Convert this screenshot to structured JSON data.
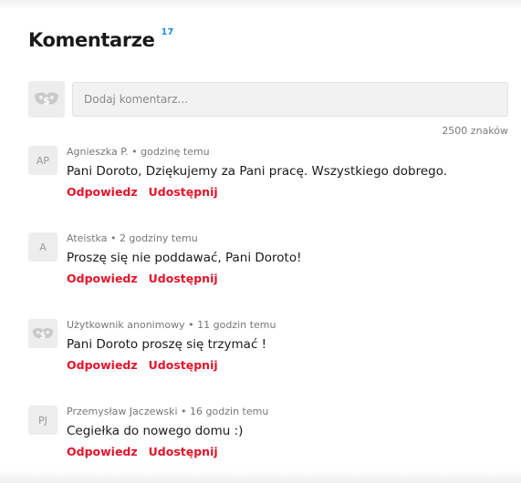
{
  "header": {
    "title": "Komentarze",
    "count": "17"
  },
  "composer": {
    "placeholder": "Dodaj komentarz...",
    "char_limit": "2500 znaków",
    "avatar_icon": "anonymous-mask-icon"
  },
  "comments": [
    {
      "avatar": "AP",
      "author": "Agnieszka P.",
      "time": "godzinę temu",
      "text": "Pani Doroto, Dziękujemy za Pani pracę. Wszystkiego dobrego.",
      "reply": "Odpowiedz",
      "share": "Udostępnij"
    },
    {
      "avatar": "A",
      "author": "Ateistka ",
      "time": "2 godziny temu",
      "text": "Proszę się nie poddawać, Pani Doroto!",
      "reply": "Odpowiedz",
      "share": "Udostępnij"
    },
    {
      "avatar": "",
      "author": "Użytkownik anonimowy",
      "time": "11 godzin temu",
      "text": "Pani Doroto proszę się trzymać !",
      "reply": "Odpowiedz",
      "share": "Udostępnij"
    },
    {
      "avatar": "PJ",
      "author": "Przemysław Jaczewski",
      "time": "16 godzin temu",
      "text": "Cegiełka do nowego domu :)",
      "reply": "Odpowiedz",
      "share": "Udostępnij"
    }
  ],
  "colors": {
    "accent": "#e3142a",
    "count": "#1f8fe0"
  }
}
